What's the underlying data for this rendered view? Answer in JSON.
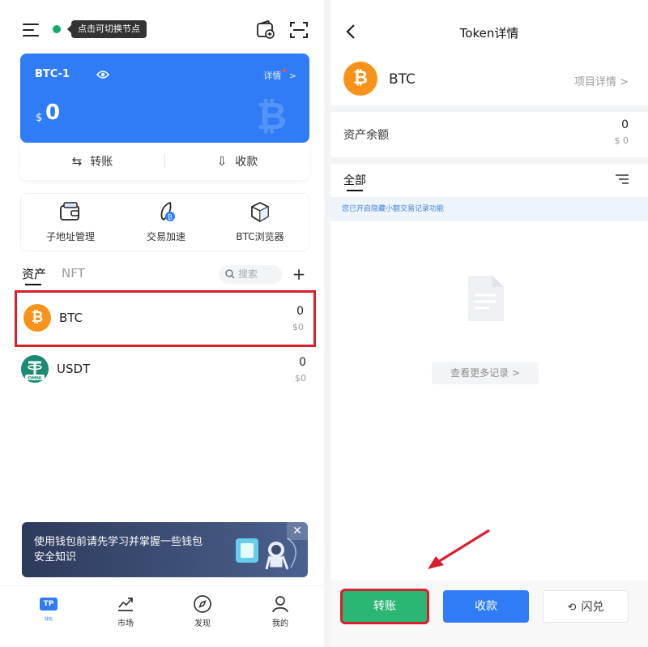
{
  "left": {
    "header": {
      "node_tip": "点击可切换节点"
    },
    "wallet": {
      "name": "BTC-1",
      "detail_label": "详情",
      "detail_arrow": ">",
      "currency_symbol": "$",
      "balance": "0",
      "actions": [
        {
          "label": "转账",
          "icon": "transfer-icon"
        },
        {
          "label": "收款",
          "icon": "receive-icon"
        }
      ]
    },
    "tools": [
      {
        "label": "子地址管理",
        "icon": "wallet-card-icon"
      },
      {
        "label": "交易加速",
        "icon": "rocket-icon"
      },
      {
        "label": "BTC浏览器",
        "icon": "cube-icon"
      }
    ],
    "tabs": {
      "assets": "资产",
      "nft": "NFT"
    },
    "search": {
      "placeholder": "搜索"
    },
    "add_label": "+",
    "assets": [
      {
        "symbol": "BTC",
        "amount": "0",
        "value": "$0",
        "badge": ""
      },
      {
        "symbol": "USDT",
        "amount": "0",
        "value": "$0",
        "badge": "OMNI"
      }
    ],
    "banner": {
      "text": "使用钱包前请先学习并掌握一些钱包安全知识",
      "close": "✕"
    },
    "nav": [
      {
        "label": "",
        "icon": "tp-wallet-icon",
        "tp": "TP",
        "sub": "钱包"
      },
      {
        "label": "市场",
        "icon": "chart-icon"
      },
      {
        "label": "发现",
        "icon": "compass-icon"
      },
      {
        "label": "我的",
        "icon": "user-icon"
      }
    ]
  },
  "right": {
    "title": "Token详情",
    "token": {
      "symbol": "BTC",
      "project_link": "项目详情 >"
    },
    "balance": {
      "label": "资产余额",
      "amount": "0",
      "usd": "$ 0"
    },
    "tab_all": "全部",
    "notice": "您已开启隐藏小额交易记录功能",
    "more_records": "查看更多记录 >",
    "buttons": {
      "send": "转账",
      "receive": "收款",
      "swap": "闪兑"
    }
  },
  "colors": {
    "primary_blue": "#2f7cf6",
    "send_green": "#2bb673",
    "highlight_red": "#d6202e",
    "btc_orange": "#f7931a",
    "usdt_green": "#1b8a73"
  }
}
